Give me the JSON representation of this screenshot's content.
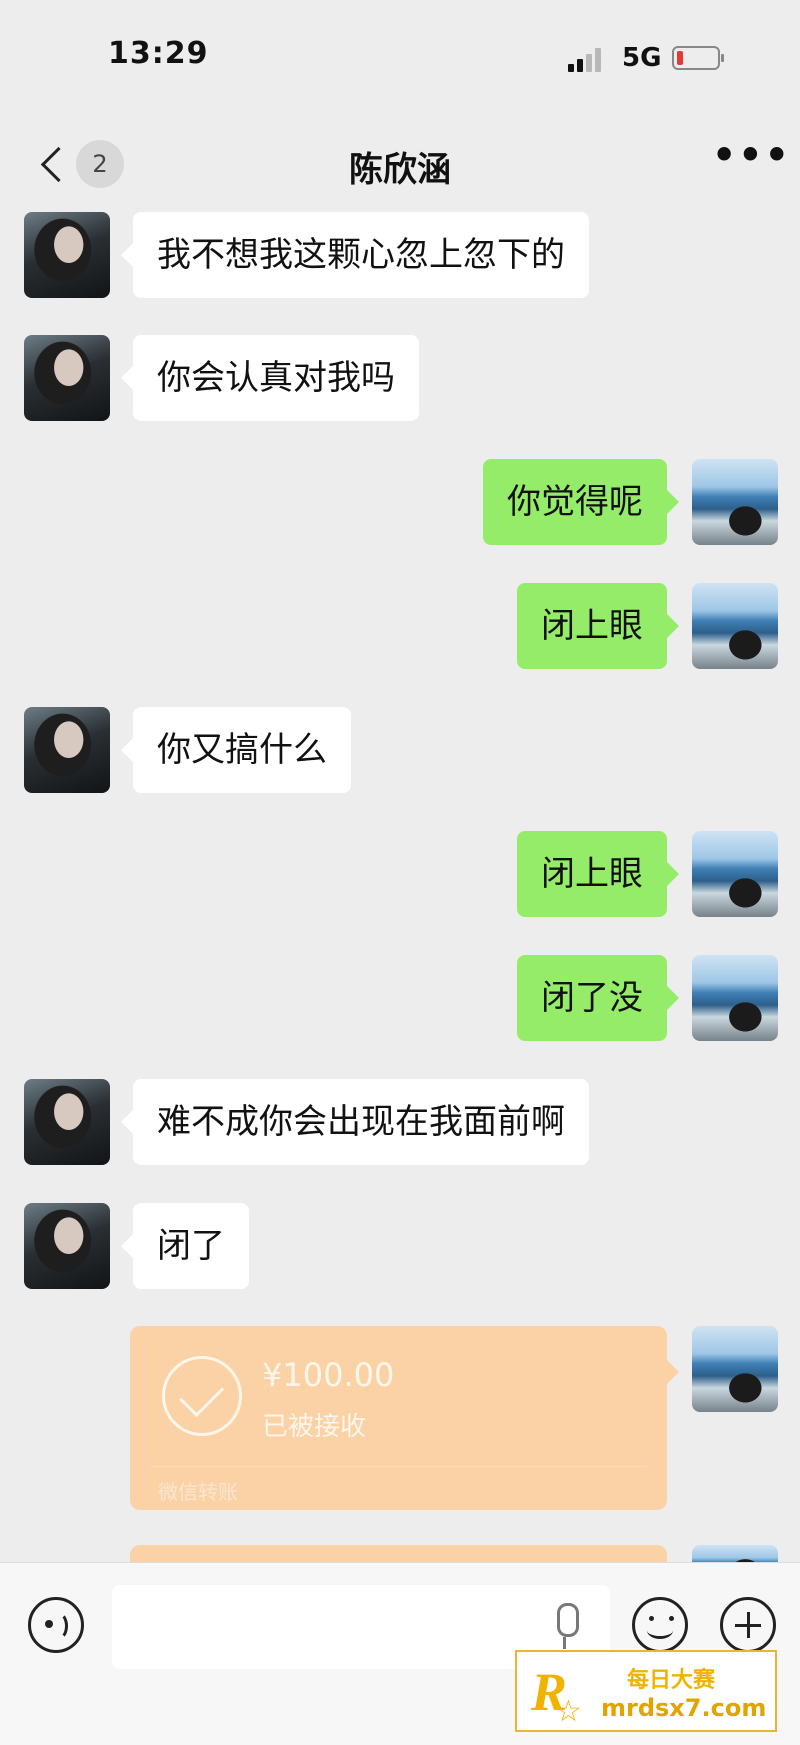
{
  "status_bar": {
    "time": "13:29",
    "network": "5G"
  },
  "header": {
    "back_badge": "2",
    "title": "陈欣涵",
    "more": "•••"
  },
  "messages": [
    {
      "side": "in",
      "text": "我不想我这颗心忽上忽下的"
    },
    {
      "side": "in",
      "text": "你会认真对我吗"
    },
    {
      "side": "out",
      "text": "你觉得呢"
    },
    {
      "side": "out",
      "text": "闭上眼"
    },
    {
      "side": "in",
      "text": "你又搞什么"
    },
    {
      "side": "out",
      "text": "闭上眼"
    },
    {
      "side": "out",
      "text": "闭了没"
    },
    {
      "side": "in",
      "text": "难不成你会出现在我面前啊"
    },
    {
      "side": "in",
      "text": "闭了"
    }
  ],
  "transfer": {
    "amount": "¥100.00",
    "status": "已被接收",
    "label": "微信转账"
  },
  "input": {
    "placeholder": ""
  },
  "watermark": {
    "logo": "R",
    "line1": "每日大赛",
    "line2": "mrdsx7.com"
  },
  "colors": {
    "outgoing_bubble": "#95ec69",
    "incoming_bubble": "#ffffff",
    "transfer": "#fbd2a6",
    "background": "#ededed"
  }
}
